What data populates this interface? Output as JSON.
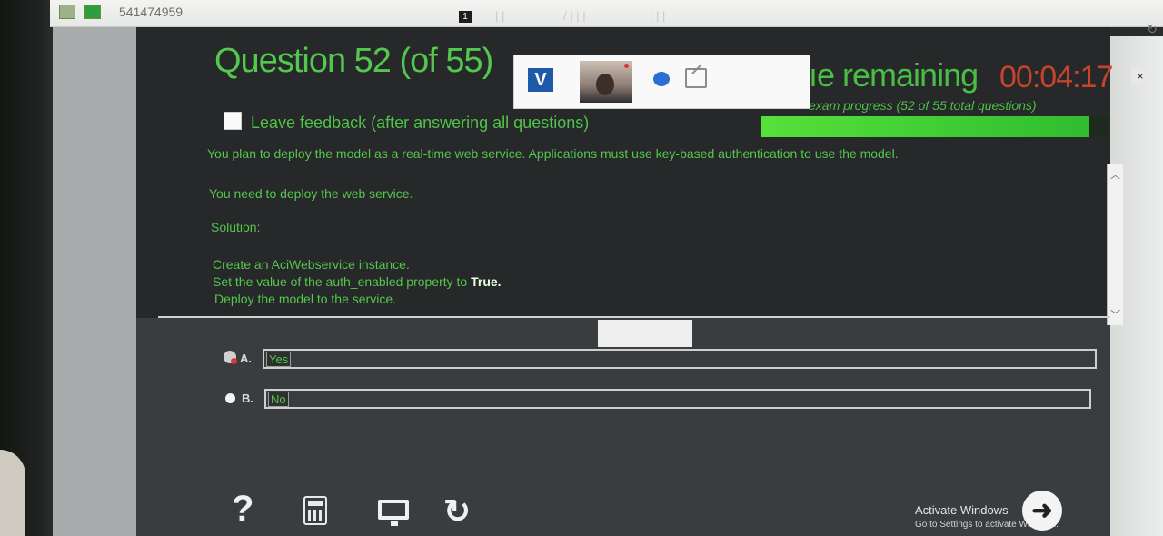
{
  "topbar": {
    "session_id": "541474959",
    "tool_number": "1"
  },
  "exam": {
    "question_title": "Question 52 (of 55)",
    "time_label": "ıe remaining",
    "time_remaining": "00:04:17",
    "close_label": "×",
    "progress_text": "exam progress (52 of 55 total questions)",
    "progress_fraction": 0.945,
    "feedback_label": "Leave feedback (after answering all questions)",
    "question_lines": [
      "You plan to deploy the model as a real-time web service. Applications must use key-based authentication to use the model.",
      "You need to deploy the web service.",
      "Solution:",
      "Create an AciWebservice instance.",
      "Set the value of the auth_enabled property to ",
      "True.",
      "Deploy the model to the service."
    ],
    "options": [
      {
        "letter": "A.",
        "text": "Yes"
      },
      {
        "letter": "B.",
        "text": "No"
      }
    ]
  },
  "proctor": {
    "logo_letter": "V"
  },
  "windows_notice": {
    "title": "Activate Windows",
    "subtitle": "Go to Settings to activate Windows."
  },
  "icons": {
    "help": "?",
    "undo": "↻",
    "next": "➜"
  },
  "colors": {
    "exam_bg": "#262829",
    "accent_green": "#52c84e",
    "timer_red": "#c8432d"
  }
}
